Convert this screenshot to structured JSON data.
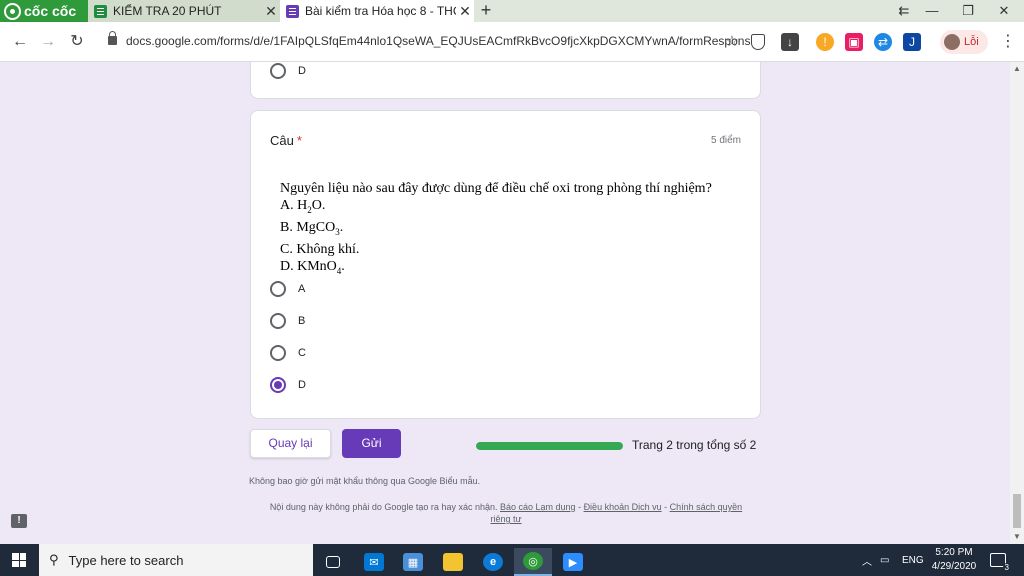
{
  "browser": {
    "brand_label": "cốc cốc",
    "tabs": [
      {
        "title": "KIỂM TRA 20 PHÚT",
        "active": false
      },
      {
        "title": "Bài kiểm tra Hóa học 8 - THC",
        "active": true
      }
    ],
    "new_tab_label": "+",
    "url": "docs.google.com/forms/d/e/1FAIpQLSfqEm44nlo1QseWA_EQJUsEACmfRkBvcO9fjcXkpDGXCMYwnA/formResponse",
    "profile_label": "Lỗi"
  },
  "form": {
    "previous_option_label": "D",
    "question": {
      "title": "Câu",
      "required_mark": "*",
      "points": "5 điểm",
      "prompt": "Nguyên liệu nào sau đây được dùng để điều chế oxi trong phòng thí nghiệm?",
      "choice_a": {
        "prefix": "A. H",
        "sub": "2",
        "suffix": "O."
      },
      "choice_b": {
        "prefix": "B. MgCO",
        "sub": "3",
        "suffix": "."
      },
      "choice_c": {
        "text": "C. Không khí."
      },
      "choice_d": {
        "prefix": "D. KMnO",
        "sub": "4",
        "suffix": "."
      },
      "options": [
        "A",
        "B",
        "C",
        "D"
      ],
      "selected": "D"
    },
    "back_label": "Quay lại",
    "submit_label": "Gửi",
    "progress_fraction": 1.0,
    "page_indicator": "Trang 2 trong tổng số 2",
    "password_notice": "Không bao giờ gửi mật khẩu thông qua Google Biểu mẫu.",
    "footer_text": "Nội dung này không phải do Google tạo ra hay xác nhận.",
    "footer_links": [
      "Báo cáo Lạm dụng",
      "Điều khoản Dịch vụ",
      "Chính sách quyền riêng tư"
    ],
    "footer_separator": " - "
  },
  "taskbar": {
    "search_placeholder": "Type here to search",
    "language": "ENG",
    "time": "5:20 PM",
    "date": "4/29/2020",
    "notification_count": "3"
  }
}
